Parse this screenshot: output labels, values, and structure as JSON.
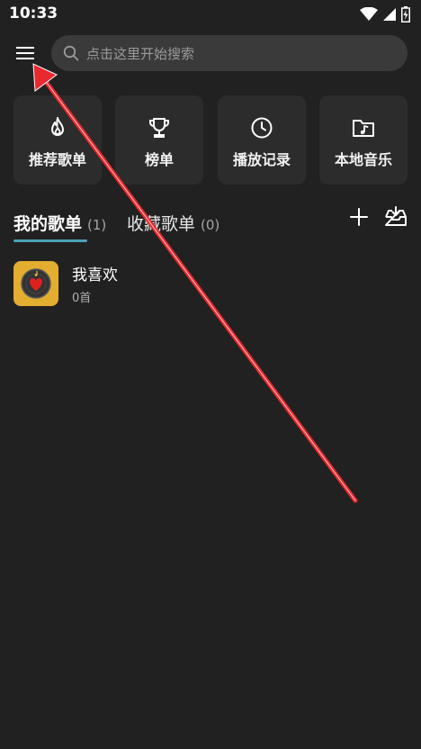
{
  "status_bar": {
    "time": "10:33",
    "icons": [
      "wifi-icon",
      "cellular-signal-icon",
      "battery-charging-icon"
    ]
  },
  "header": {
    "menu_icon": "hamburger-menu-icon",
    "search": {
      "placeholder": "点击这里开始搜索",
      "icon": "search-icon"
    }
  },
  "quick_actions": [
    {
      "label": "推荐歌单",
      "icon": "flame-icon"
    },
    {
      "label": "榜单",
      "icon": "trophy-icon"
    },
    {
      "label": "播放记录",
      "icon": "clock-icon"
    },
    {
      "label": "本地音乐",
      "icon": "music-folder-icon"
    }
  ],
  "tabs": [
    {
      "label": "我的歌单",
      "count": "(1)",
      "active": true
    },
    {
      "label": "收藏歌单",
      "count": "(0)",
      "active": false
    }
  ],
  "tab_actions": {
    "add_icon": "plus-icon",
    "import_icon": "import-inbox-icon"
  },
  "playlists": [
    {
      "name": "我喜欢",
      "count": "0首",
      "cover_icon": "heart-record-icon"
    }
  ],
  "colors": {
    "background": "#212121",
    "card": "#2c2c2c",
    "search_bg": "#3a3a3a",
    "tab_indicator": "#4aa3b5",
    "cover_bg": "#e3ad2f",
    "annotation_arrow": "#e8292f"
  }
}
